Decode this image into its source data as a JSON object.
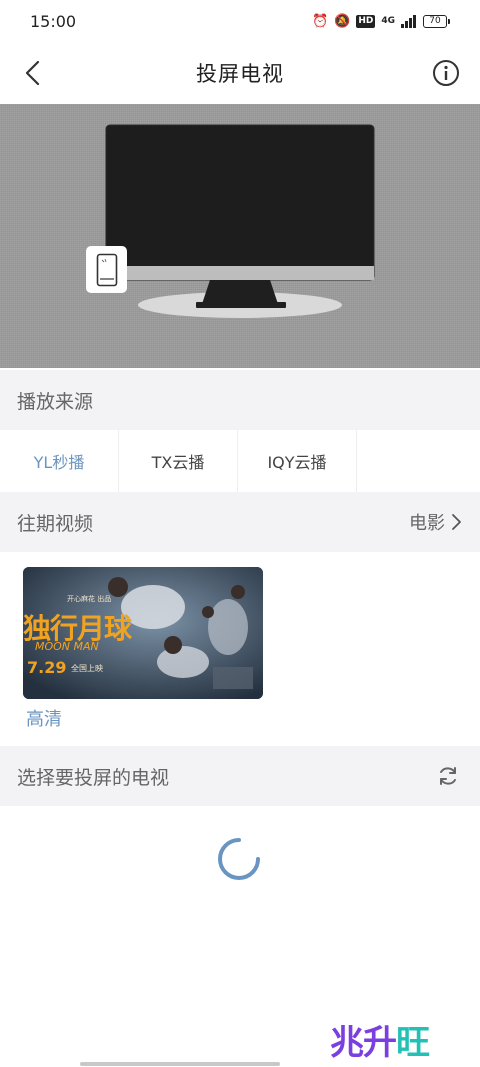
{
  "status": {
    "time": "15:00",
    "hd_badge": "HD",
    "network": "4G",
    "battery": "70"
  },
  "header": {
    "title": "投屏电视"
  },
  "sources": {
    "title": "播放来源",
    "tabs": [
      {
        "label": "YL秒播",
        "active": true
      },
      {
        "label": "TX云播",
        "active": false
      },
      {
        "label": "IQY云播",
        "active": false
      }
    ]
  },
  "past_videos": {
    "title": "往期视频",
    "category_label": "电影",
    "items": [
      {
        "poster_title": "独行月球",
        "poster_title_visible": "独行月球",
        "poster_subtitle": "MOON MAN",
        "poster_date": "7.29",
        "poster_release": "全国上映",
        "poster_top": "开心麻花 出品",
        "quality": "高清"
      }
    ]
  },
  "tv_select": {
    "title": "选择要投屏的电视"
  },
  "watermark": {
    "part1": "兆升",
    "part2": "旺"
  },
  "colors": {
    "accent": "#6a95c2",
    "section_bg": "#f3f3f5",
    "stage_bg": "#9c9c9c",
    "screen": "#1d1d1d",
    "poster_text": "#f0a321"
  },
  "icons": {
    "back": "chevron-left-icon",
    "info": "info-icon",
    "chevron_right": "chevron-right-icon",
    "refresh": "refresh-icon",
    "phone": "phone-icon"
  }
}
